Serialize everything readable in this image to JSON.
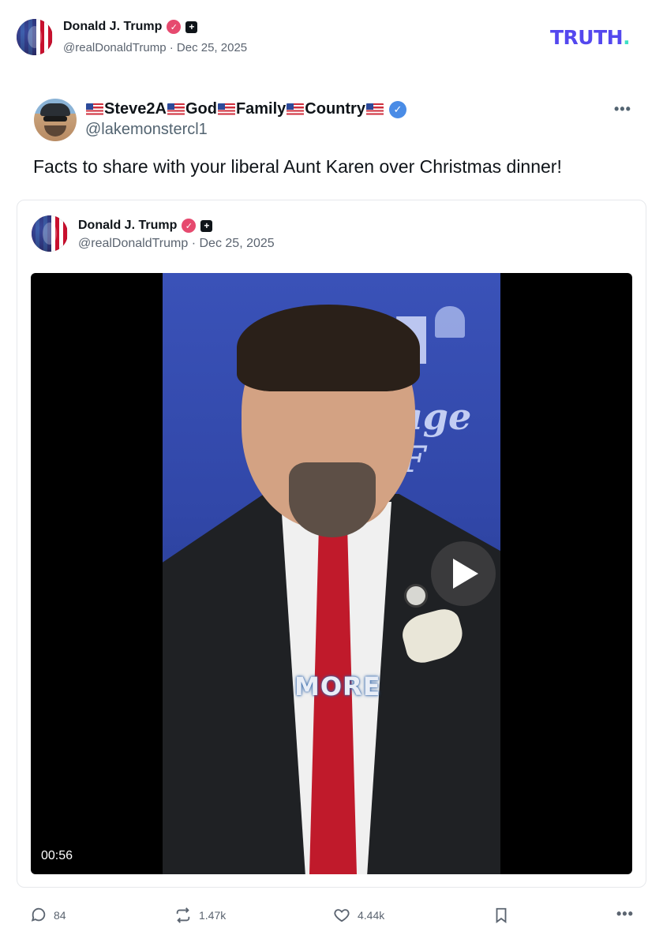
{
  "header": {
    "author_name": "Donald J. Trump",
    "author_handle": "@realDonaldTrump",
    "date": "Dec 25, 2025",
    "logo_text": "TRUTH",
    "logo_dot": "."
  },
  "quoted_tweet": {
    "display_name": "Steve2A God Family Country",
    "name_parts": [
      "Steve2A",
      "God",
      "Family",
      "Country"
    ],
    "handle": "@lakemonstercl1",
    "text": "Facts to share with your liberal Aunt Karen over Christmas dinner!",
    "more_icon": "•••"
  },
  "embedded_post": {
    "author_name": "Donald J. Trump",
    "author_handle": "@realDonaldTrump",
    "date": "Dec 25, 2025",
    "video": {
      "duration": "00:56",
      "caption": "MORE",
      "background_text": "age F"
    }
  },
  "actions": {
    "replies": "84",
    "reposts": "1.47k",
    "likes": "4.44k",
    "more": "•••"
  },
  "colors": {
    "truth_brand": "#5448ee",
    "truth_dot": "#3ddfc5",
    "verified_pink": "#e64a6f",
    "verified_blue": "#4a8ce6"
  }
}
